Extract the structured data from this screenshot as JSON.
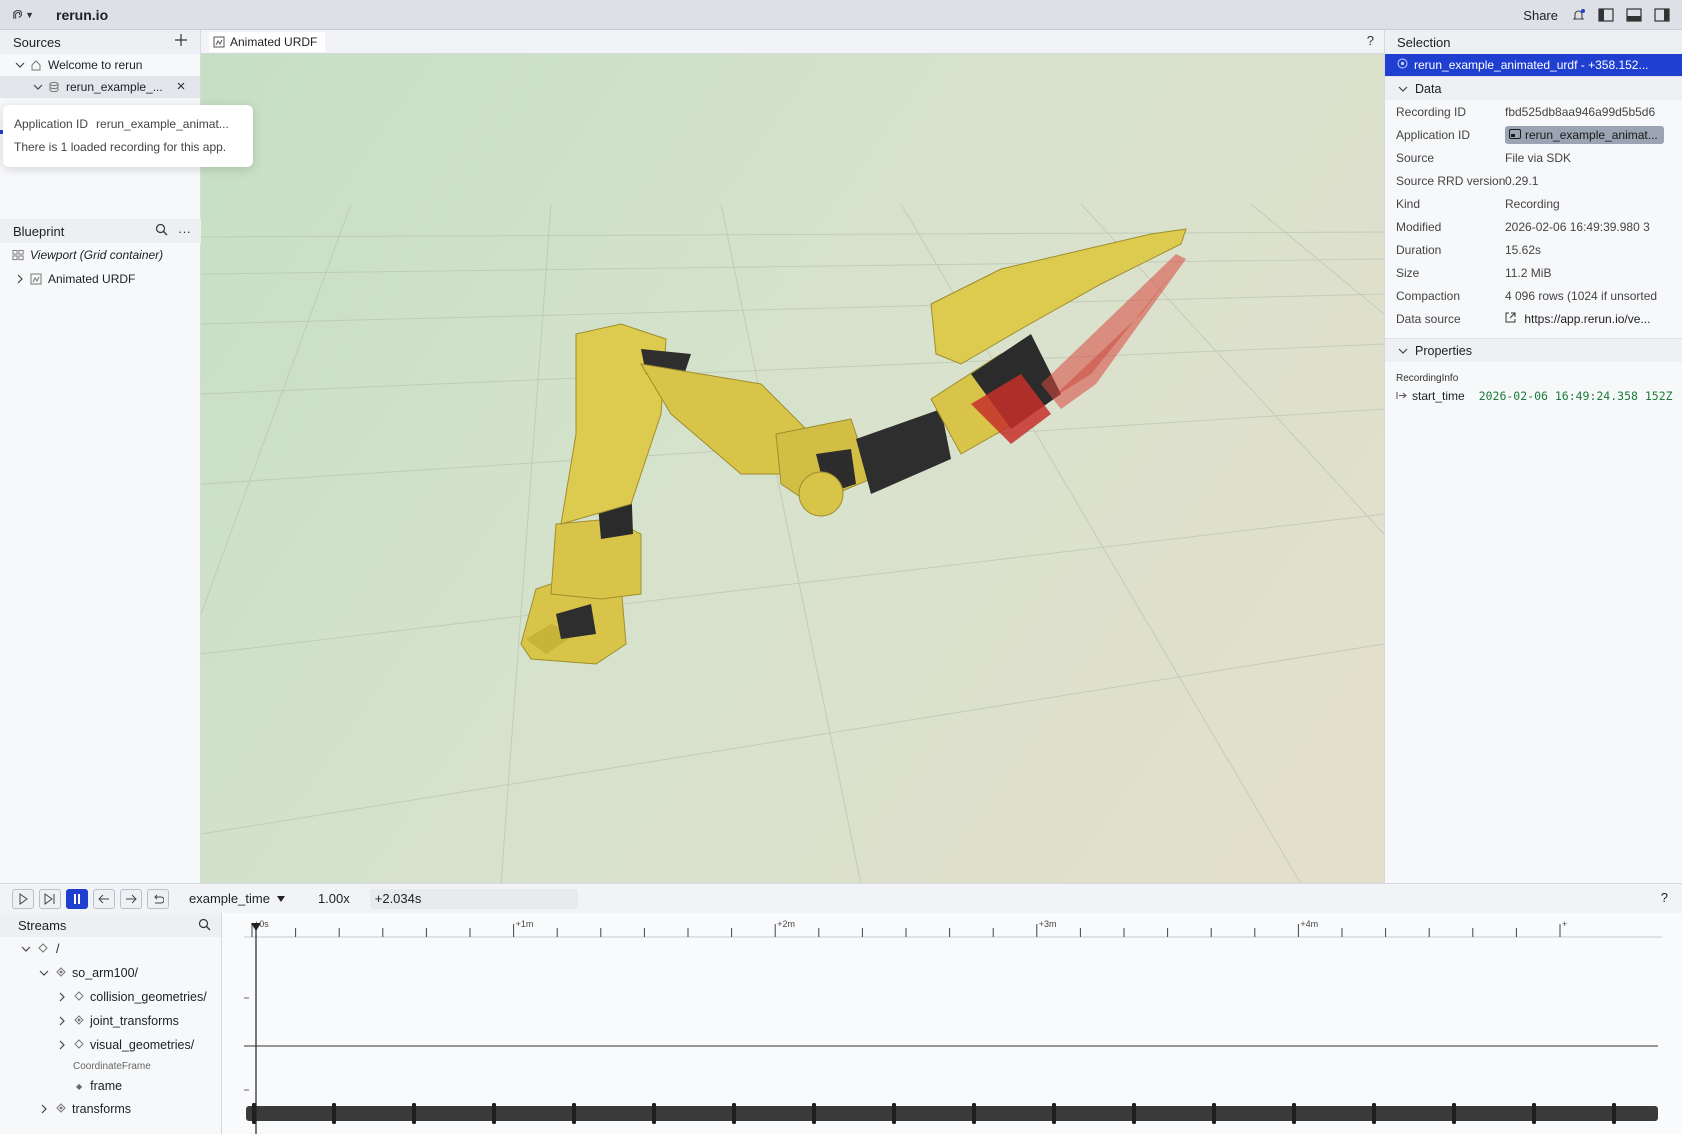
{
  "topbar": {
    "app_title": "rerun.io",
    "share_label": "Share",
    "icons": [
      "rerun-logo-icon",
      "bell-icon",
      "left-panel-toggle-icon",
      "bottom-panel-toggle-icon",
      "right-panel-toggle-icon"
    ]
  },
  "sources": {
    "title": "Sources",
    "items": [
      {
        "label": "Welcome to rerun",
        "icon": "home-icon"
      },
      {
        "label": "rerun_example_...",
        "icon": "database-icon"
      }
    ],
    "tooltip": {
      "app_id_label": "Application ID",
      "app_id_value": "rerun_example_animat...",
      "loaded_text": "There is 1 loaded recording for this app."
    }
  },
  "blueprint": {
    "title": "Blueprint",
    "viewport_label": "Viewport (Grid container)",
    "views": [
      {
        "label": "Animated URDF"
      }
    ]
  },
  "viewport": {
    "tab_label": "Animated URDF",
    "help": "?"
  },
  "selection": {
    "title": "Selection",
    "selected_item": "rerun_example_animated_urdf - +358.152...",
    "data_section": "Data",
    "rows": [
      {
        "k": "Recording ID",
        "v": "fbd525db8aa946a99d5b5d6"
      },
      {
        "k": "Application ID",
        "v": "rerun_example_animat..."
      },
      {
        "k": "Source",
        "v": "File via SDK"
      },
      {
        "k": "Source RRD version",
        "v": "0.29.1"
      },
      {
        "k": "Kind",
        "v": "Recording"
      },
      {
        "k": "Modified",
        "v": "2026-02-06 16:49:39.980 3"
      },
      {
        "k": "Duration",
        "v": "15.62s"
      },
      {
        "k": "Size",
        "v": "11.2 MiB"
      },
      {
        "k": "Compaction",
        "v": "4 096 rows (1024 if unsorted"
      },
      {
        "k": "Data source",
        "v": "https://app.rerun.io/ve..."
      }
    ],
    "properties_section": "Properties",
    "recording_info_label": "RecordingInfo",
    "start_time_label": "start_time",
    "start_time_value": "2026-02-06 16:49:24.358 152Z"
  },
  "timebar": {
    "timeline_name": "example_time",
    "speed": "1.00x",
    "current_time": "+2.034s",
    "help": "?"
  },
  "streams": {
    "title": "Streams",
    "tree": [
      {
        "label": "/",
        "depth": 0
      },
      {
        "label": "so_arm100/",
        "depth": 1
      },
      {
        "label": "collision_geometries/",
        "depth": 2
      },
      {
        "label": "joint_transforms",
        "depth": 2
      },
      {
        "label": "visual_geometries/",
        "depth": 2
      },
      {
        "label": "CoordinateFrame",
        "depth": 2
      },
      {
        "label": "frame",
        "depth": 2
      },
      {
        "label": "transforms",
        "depth": 1
      }
    ]
  },
  "timeline": {
    "ticks": [
      "+0s",
      "+1m",
      "+2m",
      "+3m",
      "+4m",
      "+"
    ]
  },
  "colors": {
    "accent": "#1f3fd1",
    "robot_yellow": "#d8c448",
    "robot_dark": "#2e2e2e",
    "gripper_red": "#d9483e"
  }
}
